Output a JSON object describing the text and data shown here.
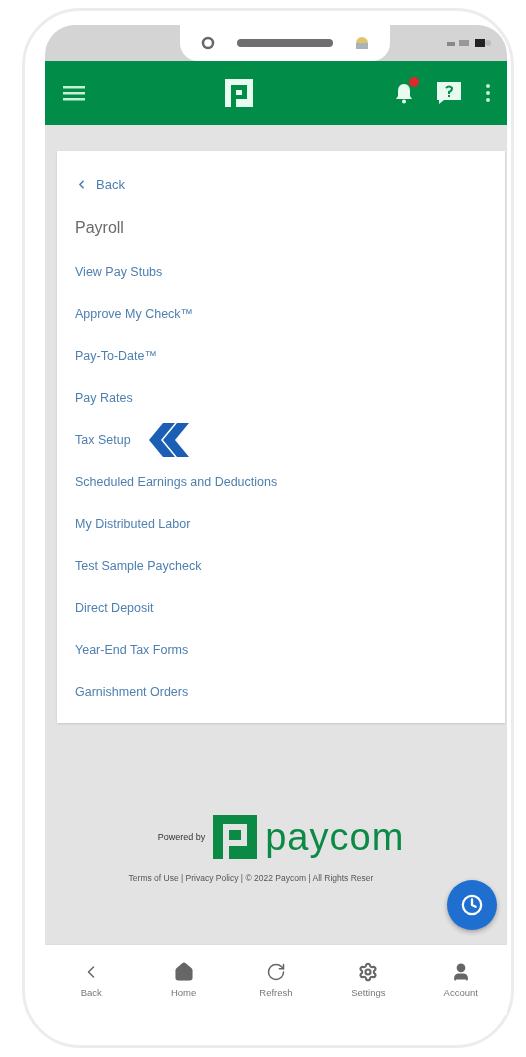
{
  "header": {
    "has_notification": true
  },
  "menu": {
    "back": "Back",
    "title": "Payroll",
    "items": [
      {
        "label": "View Pay Stubs",
        "marked": false
      },
      {
        "label": "Approve My Check™",
        "marked": false
      },
      {
        "label": "Pay-To-Date™",
        "marked": false
      },
      {
        "label": "Pay Rates",
        "marked": false
      },
      {
        "label": "Tax Setup",
        "marked": true
      },
      {
        "label": "Scheduled Earnings and Deductions",
        "marked": false
      },
      {
        "label": "My Distributed Labor",
        "marked": false
      },
      {
        "label": "Test Sample Paycheck",
        "marked": false
      },
      {
        "label": "Direct Deposit",
        "marked": false
      },
      {
        "label": "Year-End Tax Forms",
        "marked": false
      },
      {
        "label": "Garnishment Orders",
        "marked": false
      }
    ]
  },
  "footer": {
    "powered_by": "Powered by",
    "brand": "paycom",
    "legal": "Terms of Use | Privacy Policy | © 2022 Paycom | All Rights Reser"
  },
  "bottom_nav": [
    {
      "kind": "back",
      "label": "Back"
    },
    {
      "kind": "home",
      "label": "Home"
    },
    {
      "kind": "refresh",
      "label": "Refresh"
    },
    {
      "kind": "settings",
      "label": "Settings"
    },
    {
      "kind": "account",
      "label": "Account"
    }
  ]
}
